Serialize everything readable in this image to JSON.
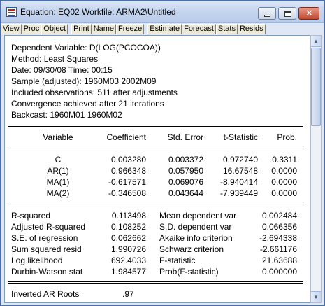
{
  "window": {
    "title": "Equation: EQ02   Workfile: ARMA2\\Untitled",
    "icon": "eviews-equation-icon"
  },
  "toolbar": {
    "buttons": [
      "View",
      "Proc",
      "Object",
      "Print",
      "Name",
      "Freeze",
      "Estimate",
      "Forecast",
      "Stats",
      "Resids"
    ]
  },
  "header": {
    "dependent": "Dependent Variable: D(LOG(PCOCOA))",
    "method": "Method: Least Squares",
    "date": "Date: 09/30/08   Time: 00:15",
    "sample": "Sample (adjusted): 1960M03 2002M09",
    "observations": "Included observations: 511 after adjustments",
    "convergence": "Convergence achieved after 21 iterations",
    "backcast": "Backcast: 1960M01 1960M02"
  },
  "coef_table": {
    "columns": [
      "Variable",
      "Coefficient",
      "Std. Error",
      "t-Statistic",
      "Prob."
    ],
    "rows": [
      [
        "C",
        "0.003280",
        "0.003372",
        "0.972740",
        "0.3311"
      ],
      [
        "AR(1)",
        "0.966348",
        "0.057950",
        "16.67548",
        "0.0000"
      ],
      [
        "MA(1)",
        "-0.617571",
        "0.069076",
        "-8.940414",
        "0.0000"
      ],
      [
        "MA(2)",
        "-0.346508",
        "0.043644",
        "-7.939449",
        "0.0000"
      ]
    ]
  },
  "stats": {
    "rows": [
      [
        "R-squared",
        "0.113498",
        "Mean dependent var",
        "0.002484"
      ],
      [
        "Adjusted R-squared",
        "0.108252",
        "S.D. dependent var",
        "0.066356"
      ],
      [
        "S.E. of regression",
        "0.062662",
        "Akaike info criterion",
        "-2.694338"
      ],
      [
        "Sum squared resid",
        "1.990726",
        "Schwarz criterion",
        "-2.661176"
      ],
      [
        "Log likelihood",
        "692.4033",
        "F-statistic",
        "21.63688"
      ],
      [
        "Durbin-Watson stat",
        "1.984577",
        "Prob(F-statistic)",
        "0.000000"
      ]
    ]
  },
  "roots": {
    "label": "Inverted AR Roots",
    "value": ".97"
  }
}
